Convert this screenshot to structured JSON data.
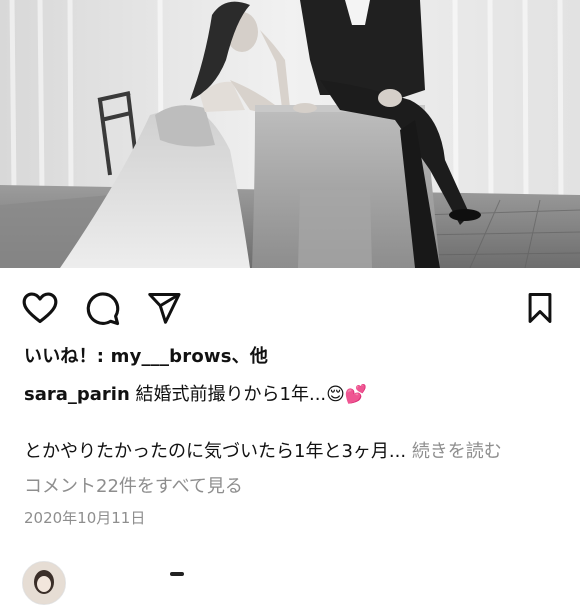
{
  "post": {
    "photo_alt": "wedding pre-shoot photo",
    "likes_text": "いいね！: my___brows、他",
    "caption_user": "sara_parin",
    "caption_text": "結婚式前撮りから1年...",
    "caption_emojis": "😌💕",
    "body_text": "とかやりたかったのに気づいたら1年と3ヶ月...",
    "more_label": "続きを読む",
    "comments_label": "コメント22件をすべて見る",
    "date": "2020年10月11日"
  },
  "icons": {
    "like": "heart-icon",
    "comment": "comment-icon",
    "share": "send-icon",
    "save": "bookmark-icon"
  },
  "colors": {
    "text": "#111111",
    "secondary": "#8e8e8e",
    "background": "#ffffff"
  }
}
